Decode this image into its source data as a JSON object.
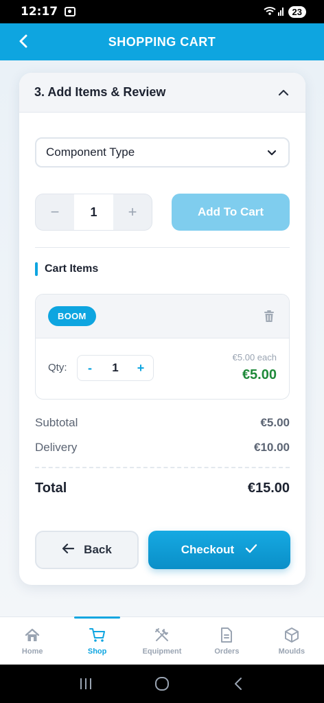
{
  "status_bar": {
    "time": "12:17",
    "battery": "23"
  },
  "header": {
    "title": "SHOPPING CART"
  },
  "section": {
    "title": "3. Add Items & Review",
    "component_select": {
      "value": "Component Type"
    },
    "quantity": {
      "value": "1",
      "minus": "−",
      "plus": "+"
    },
    "add_to_cart_label": "Add To Cart"
  },
  "cart": {
    "title": "Cart Items",
    "items": [
      {
        "badge": "BOOM",
        "qty_label": "Qty:",
        "qty": "1",
        "minus": "-",
        "plus": "+",
        "unit_price": "€5.00 each",
        "line_total": "€5.00"
      }
    ]
  },
  "summary": {
    "subtotal_label": "Subtotal",
    "subtotal": "€5.00",
    "delivery_label": "Delivery",
    "delivery": "€10.00",
    "total_label": "Total",
    "total": "€15.00"
  },
  "actions": {
    "back_label": "Back",
    "checkout_label": "Checkout"
  },
  "bottom_nav": [
    {
      "label": "Home",
      "icon": "home-icon",
      "active": false
    },
    {
      "label": "Shop",
      "icon": "cart-icon",
      "active": true
    },
    {
      "label": "Equipment",
      "icon": "tools-icon",
      "active": false
    },
    {
      "label": "Orders",
      "icon": "document-icon",
      "active": false
    },
    {
      "label": "Moulds",
      "icon": "cube-icon",
      "active": false
    }
  ],
  "colors": {
    "accent": "#0ea5e0",
    "price_green": "#1f8a3a",
    "add_button_disabled": "#7fcdee"
  }
}
